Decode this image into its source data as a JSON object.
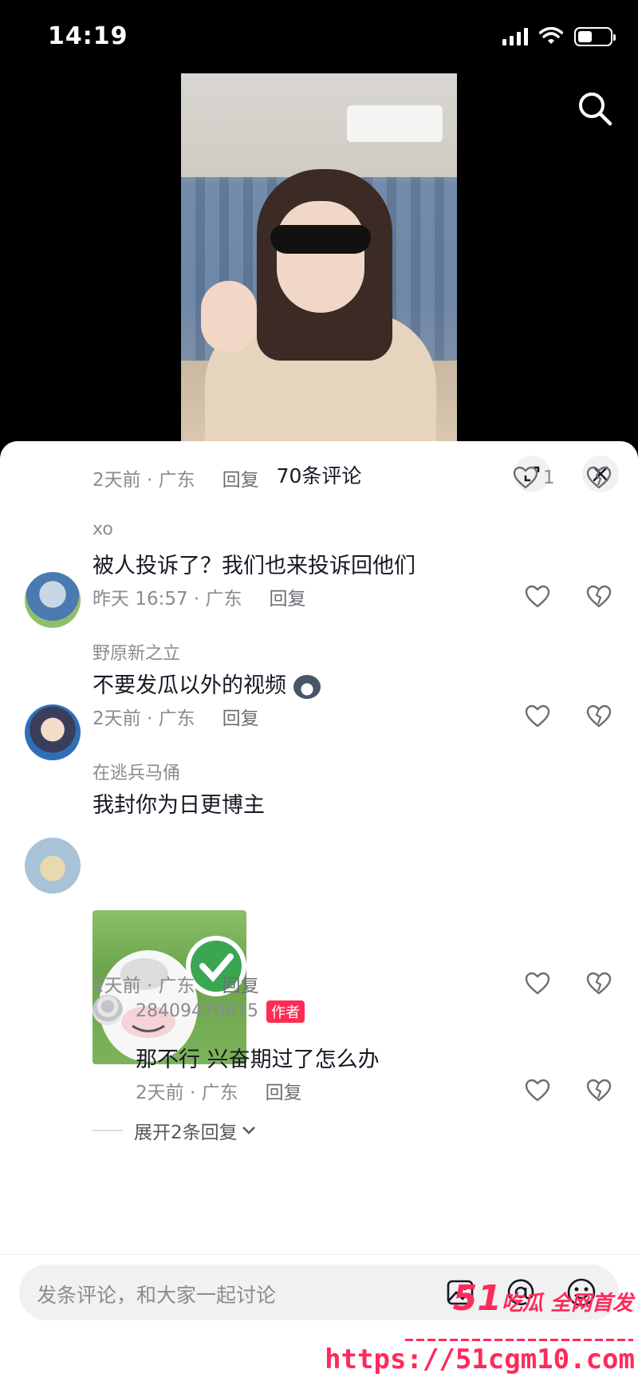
{
  "status_bar": {
    "time": "14:19"
  },
  "comment_panel": {
    "title": "70条评论",
    "comments": [
      {
        "time": "2天前 · 广东",
        "reply": "回复",
        "likes": "1"
      },
      {
        "user": "xo",
        "text": "被人投诉了？我们也来投诉回他们",
        "time": "昨天 16:57 · 广东",
        "reply": "回复"
      },
      {
        "user": "野原新之立",
        "text": "不要发瓜以外的视频",
        "time": "2天前 · 广东",
        "reply": "回复"
      },
      {
        "user": "在逃兵马俑",
        "text": "我封你为日更博主",
        "time": "2天前 · 广东",
        "reply": "回复"
      }
    ],
    "sub_reply": {
      "user": "28409470615",
      "badge": "作者",
      "text": "那不行 兴奋期过了怎么办",
      "time": "2天前 · 广东",
      "reply": "回复"
    },
    "expand_more": "展开2条回复"
  },
  "input_bar": {
    "placeholder": "发条评论，和大家一起讨论"
  },
  "watermark": {
    "brand_num": "51",
    "brand_text": "吃瓜 全网首发",
    "url": "https://51cgm10.com"
  }
}
